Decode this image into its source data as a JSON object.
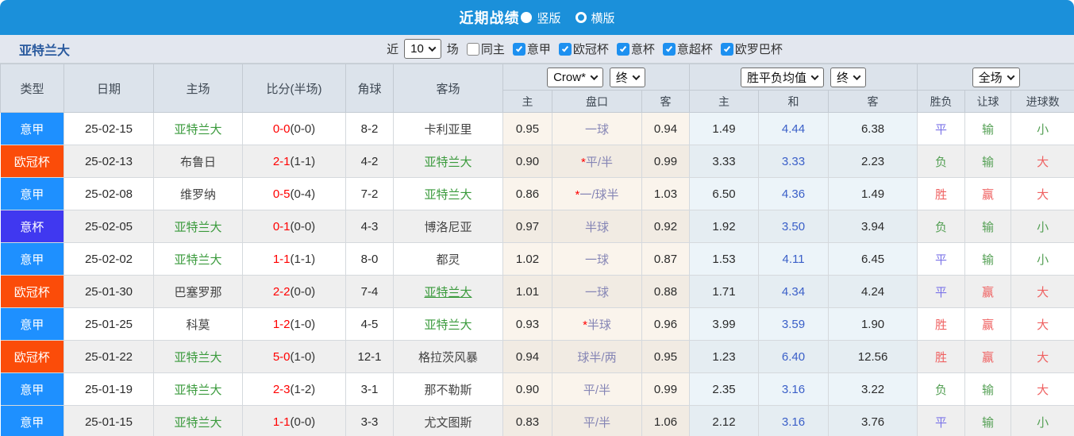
{
  "titlebar": {
    "title": "近期战绩",
    "radio_vertical": "竖版",
    "radio_horizontal": "横版",
    "selected": "竖版"
  },
  "filter": {
    "team": "亚特兰大",
    "near_label": "近",
    "count_value": "10",
    "matches_label": "场",
    "checkboxes": [
      {
        "label": "同主",
        "checked": false
      },
      {
        "label": "意甲",
        "checked": true
      },
      {
        "label": "欧冠杯",
        "checked": true
      },
      {
        "label": "意杯",
        "checked": true
      },
      {
        "label": "意超杯",
        "checked": true
      },
      {
        "label": "欧罗巴杯",
        "checked": true
      }
    ]
  },
  "table": {
    "static_headers": [
      "类型",
      "日期",
      "主场",
      "比分(半场)",
      "角球",
      "客场"
    ],
    "odds_group": {
      "select_provider": "Crow*",
      "select_time": "终",
      "subheaders": [
        "主",
        "盘口",
        "客"
      ]
    },
    "avg_group": {
      "select_provider": "胜平负均值",
      "select_time": "终",
      "subheaders": [
        "主",
        "和",
        "客"
      ]
    },
    "result_group": {
      "select_scope": "全场",
      "subheaders": [
        "胜负",
        "让球",
        "进球数"
      ]
    },
    "rows": [
      {
        "type": "意甲",
        "type_key": "serie_a",
        "date": "25-02-15",
        "home": "亚特兰大",
        "home_hl": true,
        "score": "0-0",
        "half": "(0-0)",
        "corner": "8-2",
        "away": "卡利亚里",
        "away_hl": false,
        "away_underline": false,
        "o_home": "0.95",
        "star": false,
        "handicap": "一球",
        "o_away": "0.94",
        "avg_home": "1.49",
        "avg_draw": "4.44",
        "avg_away": "6.38",
        "r_wdl": "平",
        "r_wdl_c": "b",
        "r_let": "输",
        "r_let_c": "g",
        "r_goal": "小",
        "r_goal_c": "g"
      },
      {
        "type": "欧冠杯",
        "type_key": "ucl",
        "date": "25-02-13",
        "home": "布鲁日",
        "home_hl": false,
        "score": "2-1",
        "half": "(1-1)",
        "corner": "4-2",
        "away": "亚特兰大",
        "away_hl": true,
        "away_underline": false,
        "o_home": "0.90",
        "star": true,
        "handicap": "平/半",
        "o_away": "0.99",
        "avg_home": "3.33",
        "avg_draw": "3.33",
        "avg_away": "2.23",
        "r_wdl": "负",
        "r_wdl_c": "g",
        "r_let": "输",
        "r_let_c": "g",
        "r_goal": "大",
        "r_goal_c": "r"
      },
      {
        "type": "意甲",
        "type_key": "serie_a",
        "date": "25-02-08",
        "home": "维罗纳",
        "home_hl": false,
        "score": "0-5",
        "half": "(0-4)",
        "corner": "7-2",
        "away": "亚特兰大",
        "away_hl": true,
        "away_underline": false,
        "o_home": "0.86",
        "star": true,
        "handicap": "一/球半",
        "o_away": "1.03",
        "avg_home": "6.50",
        "avg_draw": "4.36",
        "avg_away": "1.49",
        "r_wdl": "胜",
        "r_wdl_c": "r",
        "r_let": "赢",
        "r_let_c": "r",
        "r_goal": "大",
        "r_goal_c": "r"
      },
      {
        "type": "意杯",
        "type_key": "coppa",
        "date": "25-02-05",
        "home": "亚特兰大",
        "home_hl": true,
        "score": "0-1",
        "half": "(0-0)",
        "corner": "4-3",
        "away": "博洛尼亚",
        "away_hl": false,
        "away_underline": false,
        "o_home": "0.97",
        "star": false,
        "handicap": "半球",
        "o_away": "0.92",
        "avg_home": "1.92",
        "avg_draw": "3.50",
        "avg_away": "3.94",
        "r_wdl": "负",
        "r_wdl_c": "g",
        "r_let": "输",
        "r_let_c": "g",
        "r_goal": "小",
        "r_goal_c": "g"
      },
      {
        "type": "意甲",
        "type_key": "serie_a",
        "date": "25-02-02",
        "home": "亚特兰大",
        "home_hl": true,
        "score": "1-1",
        "half": "(1-1)",
        "corner": "8-0",
        "away": "都灵",
        "away_hl": false,
        "away_underline": false,
        "o_home": "1.02",
        "star": false,
        "handicap": "一球",
        "o_away": "0.87",
        "avg_home": "1.53",
        "avg_draw": "4.11",
        "avg_away": "6.45",
        "r_wdl": "平",
        "r_wdl_c": "b",
        "r_let": "输",
        "r_let_c": "g",
        "r_goal": "小",
        "r_goal_c": "g"
      },
      {
        "type": "欧冠杯",
        "type_key": "ucl",
        "date": "25-01-30",
        "home": "巴塞罗那",
        "home_hl": false,
        "score": "2-2",
        "half": "(0-0)",
        "corner": "7-4",
        "away": "亚特兰大",
        "away_hl": true,
        "away_underline": true,
        "o_home": "1.01",
        "star": false,
        "handicap": "一球",
        "o_away": "0.88",
        "avg_home": "1.71",
        "avg_draw": "4.34",
        "avg_away": "4.24",
        "r_wdl": "平",
        "r_wdl_c": "b",
        "r_let": "赢",
        "r_let_c": "r",
        "r_goal": "大",
        "r_goal_c": "r"
      },
      {
        "type": "意甲",
        "type_key": "serie_a",
        "date": "25-01-25",
        "home": "科莫",
        "home_hl": false,
        "score": "1-2",
        "half": "(1-0)",
        "corner": "4-5",
        "away": "亚特兰大",
        "away_hl": true,
        "away_underline": false,
        "o_home": "0.93",
        "star": true,
        "handicap": "半球",
        "o_away": "0.96",
        "avg_home": "3.99",
        "avg_draw": "3.59",
        "avg_away": "1.90",
        "r_wdl": "胜",
        "r_wdl_c": "r",
        "r_let": "赢",
        "r_let_c": "r",
        "r_goal": "大",
        "r_goal_c": "r"
      },
      {
        "type": "欧冠杯",
        "type_key": "ucl",
        "date": "25-01-22",
        "home": "亚特兰大",
        "home_hl": true,
        "score": "5-0",
        "half": "(1-0)",
        "corner": "12-1",
        "away": "格拉茨风暴",
        "away_hl": false,
        "away_underline": false,
        "o_home": "0.94",
        "star": false,
        "handicap": "球半/两",
        "o_away": "0.95",
        "avg_home": "1.23",
        "avg_draw": "6.40",
        "avg_away": "12.56",
        "r_wdl": "胜",
        "r_wdl_c": "r",
        "r_let": "赢",
        "r_let_c": "r",
        "r_goal": "大",
        "r_goal_c": "r"
      },
      {
        "type": "意甲",
        "type_key": "serie_a",
        "date": "25-01-19",
        "home": "亚特兰大",
        "home_hl": true,
        "score": "2-3",
        "half": "(1-2)",
        "corner": "3-1",
        "away": "那不勒斯",
        "away_hl": false,
        "away_underline": false,
        "o_home": "0.90",
        "star": false,
        "handicap": "平/半",
        "o_away": "0.99",
        "avg_home": "2.35",
        "avg_draw": "3.16",
        "avg_away": "3.22",
        "r_wdl": "负",
        "r_wdl_c": "g",
        "r_let": "输",
        "r_let_c": "g",
        "r_goal": "大",
        "r_goal_c": "r"
      },
      {
        "type": "意甲",
        "type_key": "serie_a",
        "date": "25-01-15",
        "home": "亚特兰大",
        "home_hl": true,
        "score": "1-1",
        "half": "(0-0)",
        "corner": "3-3",
        "away": "尤文图斯",
        "away_hl": false,
        "away_underline": false,
        "o_home": "0.83",
        "star": false,
        "handicap": "平/半",
        "o_away": "1.06",
        "avg_home": "2.12",
        "avg_draw": "3.16",
        "avg_away": "3.76",
        "r_wdl": "平",
        "r_wdl_c": "b",
        "r_let": "输",
        "r_let_c": "g",
        "r_goal": "小",
        "r_goal_c": "g"
      }
    ]
  },
  "colors": {
    "topbar_blue": "#1b90da",
    "type_serie_a": "#1e90ff",
    "type_ucl": "#fb4c09",
    "type_coppa": "#4038f0",
    "result_red": "#ef6161",
    "result_green": "#55a055",
    "result_blue": "#7b74e8",
    "team_green": "#3a9a3c",
    "score_red": "#ff0000",
    "draw_avg_blue": "#3a5fc8"
  }
}
